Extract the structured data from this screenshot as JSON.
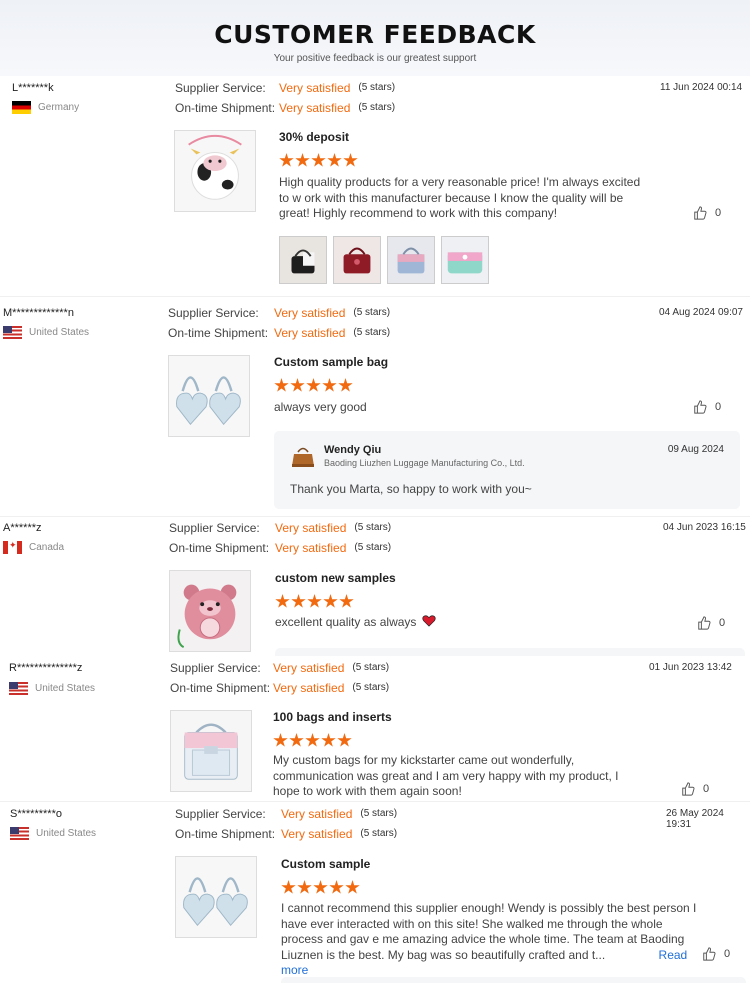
{
  "header": {
    "title": "CUSTOMER FEEDBACK",
    "subtitle": "Your positive feedback is our greatest support"
  },
  "labels": {
    "supplier_service": "Supplier Service:",
    "ontime_shipment": "On-time Shipment:"
  },
  "reviews": [
    {
      "user": "L*******k",
      "country": "Germany",
      "flag_icon": "germany-flag-icon",
      "supplier_rating": "Very satisfied",
      "supplier_stars": "(5 stars)",
      "shipment_rating": "Very satisfied",
      "shipment_stars": "(5 stars)",
      "date": "11 Jun 2024 00:14",
      "title": "30% deposit",
      "stars": 5,
      "text": "High quality products for a very reasonable price! I'm always excited to w ork with this manufacturer because I know the quality will be great! Highly recommend to work with this company!",
      "likes": "0",
      "photos_count": 4
    },
    {
      "user": "M*************n",
      "country": "United States",
      "flag_icon": "us-flag-icon",
      "supplier_rating": "Very satisfied",
      "supplier_stars": "(5 stars)",
      "shipment_rating": "Very satisfied",
      "shipment_stars": "(5 stars)",
      "date": "04 Aug 2024 09:07",
      "title": "Custom sample bag",
      "stars": 5,
      "text": "always very good",
      "likes": "0",
      "reply": {
        "name": "Wendy Qiu",
        "company": "Baoding Liuzhen Luggage Manufacturing Co., Ltd.",
        "date": "09 Aug 2024",
        "text": "Thank you Marta, so happy to work with you~"
      }
    },
    {
      "user": "A******z",
      "country": "Canada",
      "flag_icon": "canada-flag-icon",
      "supplier_rating": "Very satisfied",
      "supplier_stars": "(5 stars)",
      "shipment_rating": "Very satisfied",
      "shipment_stars": "(5 stars)",
      "date": "04 Jun 2023 16:15",
      "title": "custom new samples",
      "stars": 5,
      "text": "excellent quality as always",
      "likes": "0"
    },
    {
      "user": "R**************z",
      "country": "United States",
      "flag_icon": "us-flag-icon",
      "supplier_rating": "Very satisfied",
      "supplier_stars": "(5 stars)",
      "shipment_rating": "Very satisfied",
      "shipment_stars": "(5 stars)",
      "date": "01 Jun 2023 13:42",
      "title": "100 bags and inserts",
      "stars": 5,
      "text": "My custom bags for my kickstarter came out wonderfully, communication was great and I am very happy with my product, I hope to work with them again soon!",
      "likes": "0"
    },
    {
      "user": "S*********o",
      "country": "United States",
      "flag_icon": "us-flag-icon",
      "supplier_rating": "Very satisfied",
      "supplier_stars": "(5 stars)",
      "shipment_rating": "Very satisfied",
      "shipment_stars": "(5 stars)",
      "date": "26 May 2024 19:31",
      "title": "Custom sample",
      "stars": 5,
      "text": "I cannot recommend this supplier enough! Wendy is possibly the best person I have ever interacted with on this site! She walked me through the whole process and gav e me amazing advice the whole time. The team at Baoding Liuznen is the best. My bag was so beautifully crafted and t...",
      "read_more": "Read more",
      "likes": "0"
    }
  ],
  "colors": {
    "accent_orange": "#f26a10",
    "link_blue": "#1f6fd8"
  }
}
